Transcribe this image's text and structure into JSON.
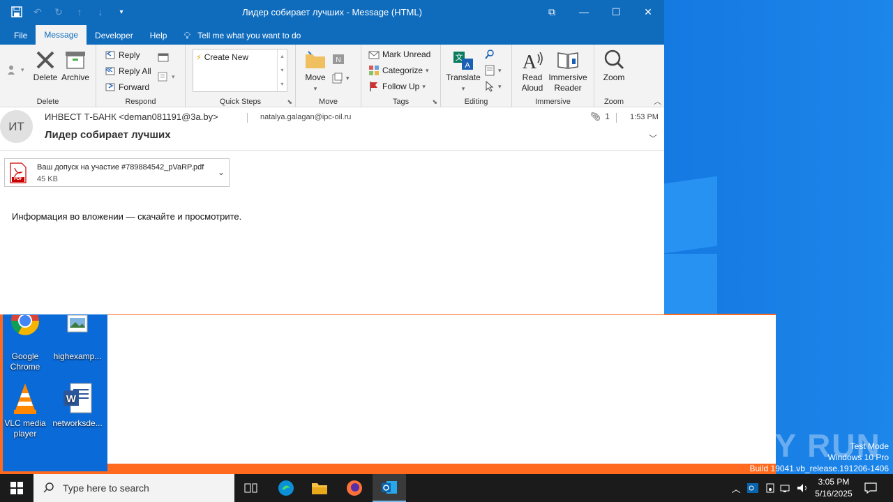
{
  "window": {
    "title": "Лидер собирает лучших  -  Message (HTML)",
    "controls": {
      "restore_icon": "⧉",
      "minimize": "—",
      "maximize": "☐",
      "close": "✕"
    }
  },
  "menu": {
    "items": [
      "File",
      "Message",
      "Developer",
      "Help"
    ],
    "tell_me": "Tell me what you want to do"
  },
  "ribbon": {
    "delete_group": {
      "delete": "Delete",
      "archive": "Archive",
      "label": "Delete"
    },
    "respond_group": {
      "reply": "Reply",
      "reply_all": "Reply All",
      "forward": "Forward",
      "label": "Respond"
    },
    "quicksteps_group": {
      "create_new": "Create New",
      "label": "Quick Steps"
    },
    "move_group": {
      "move": "Move",
      "label": "Move"
    },
    "tags_group": {
      "mark_unread": "Mark Unread",
      "categorize": "Categorize",
      "follow_up": "Follow Up",
      "label": "Tags"
    },
    "editing_group": {
      "translate": "Translate",
      "label": "Editing"
    },
    "immersive_group": {
      "read_aloud_1": "Read",
      "read_aloud_2": "Aloud",
      "reader_1": "Immersive",
      "reader_2": "Reader",
      "label": "Immersive"
    },
    "zoom_group": {
      "zoom": "Zoom",
      "label": "Zoom"
    }
  },
  "message": {
    "avatar_initials": "ИТ",
    "sender": "ИНВЕСТ Т-БАНК <deman081191@3a.by>",
    "recipient": "natalya.galagan@ipc-oil.ru",
    "attachment_count": "1",
    "time": "1:53 PM",
    "subject": "Лидер собирает лучших",
    "attachment": {
      "name": "Ваш допуск на участие #789884542_pVaRP.pdf",
      "size": "45 KB",
      "badge": "PDF"
    },
    "body": "Информация во вложении — скачайте и просмотрите."
  },
  "desktop": {
    "icons": [
      {
        "label": "Google Chrome",
        "icon": "chrome-icon"
      },
      {
        "label": "highexamp...",
        "icon": "image-file-icon"
      },
      {
        "label": "VLC media player",
        "icon": "vlc-icon"
      },
      {
        "label": "networksde...",
        "icon": "word-doc-icon"
      }
    ],
    "watermark": {
      "line1": "Test Mode",
      "line2": "Windows 10 Pro",
      "line3": "Build 19041.vb_release.191206-1406"
    },
    "anyrun": "ANY RUN"
  },
  "taskbar": {
    "search_placeholder": "Type here to search",
    "time": "3:05 PM",
    "date": "5/16/2025"
  }
}
